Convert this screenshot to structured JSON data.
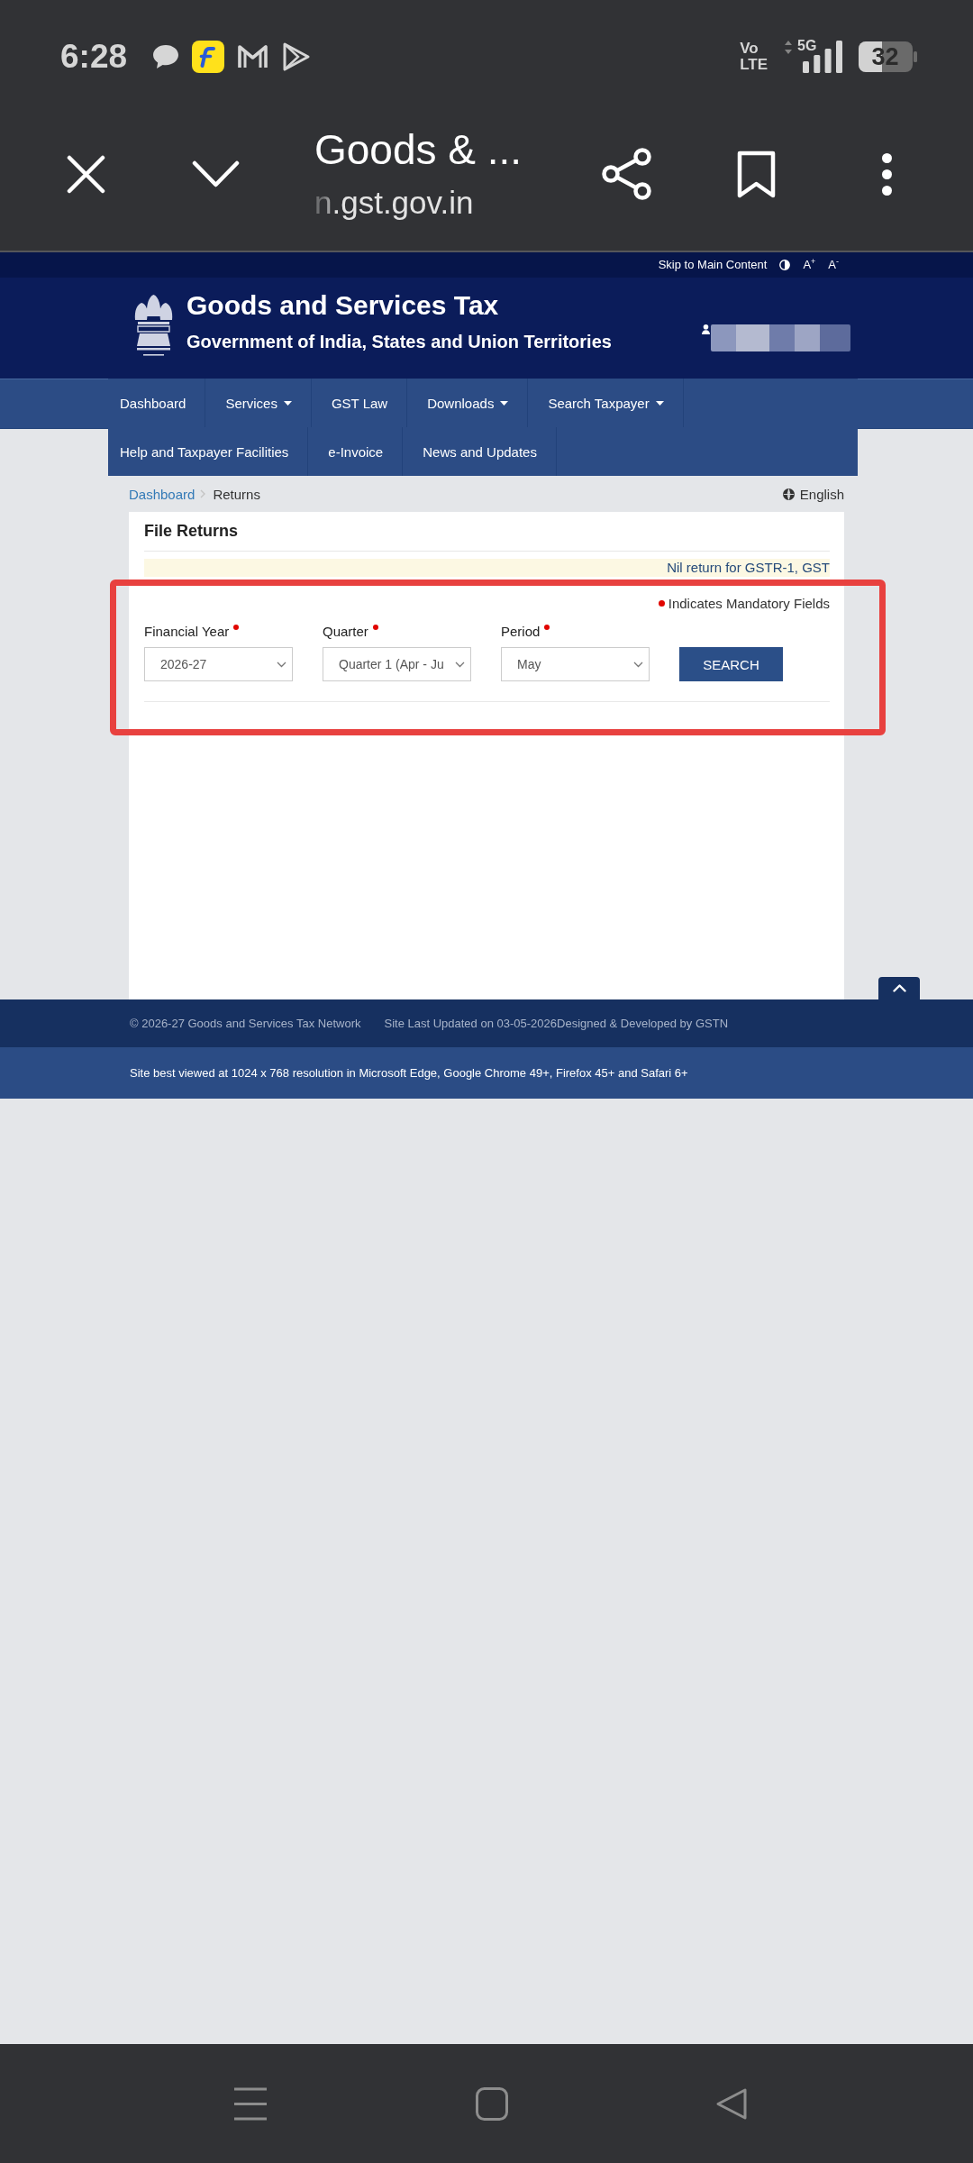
{
  "status_bar": {
    "time": "6:28",
    "volte": [
      "Vo",
      "LTE"
    ],
    "network": "5G",
    "battery": "32"
  },
  "browser_bar": {
    "title": "Goods & ...",
    "url": "n.gst.gov.in"
  },
  "site_toolbar": {
    "skip_link": "Skip to Main Content",
    "font_controls": [
      "A$^{+}$",
      "A$^{-}$"
    ]
  },
  "header": {
    "title": "Goods and Services Tax",
    "subtitle": "Government of India, States and Union Territories"
  },
  "nav": {
    "items": [
      {
        "label": "Dashboard",
        "dropdown": false
      },
      {
        "label": "Services",
        "dropdown": true
      },
      {
        "label": "GST Law",
        "dropdown": false
      },
      {
        "label": "Downloads",
        "dropdown": true
      },
      {
        "label": "Search Taxpayer",
        "dropdown": true
      },
      {
        "label": "Help and Taxpayer Facilities",
        "dropdown": false
      },
      {
        "label": "e-Invoice",
        "dropdown": false
      },
      {
        "label": "News and Updates",
        "dropdown": false
      }
    ]
  },
  "breadcrumb": [
    {
      "label": "Dashboard",
      "kind": "link"
    },
    {
      "label": "Returns",
      "kind": "current"
    }
  ],
  "language": "English",
  "card": {
    "title": "File Returns",
    "notice": "Nil return for GSTR-1, GST",
    "mandatory_note": "Indicates Mandatory Fields",
    "fields": [
      {
        "label": "Financial Year",
        "required": true,
        "value": "2026-27"
      },
      {
        "label": "Quarter",
        "required": true,
        "value": "Quarter 1 (Apr - Ju"
      },
      {
        "label": "Period",
        "required": true,
        "value": "May"
      }
    ],
    "button": "SEARCH"
  },
  "footer": {
    "copyright": "© 2026-27 Goods and Services Tax Network",
    "updated": "Site Last Updated on 03-05-2026Designed & Developed by GSTN",
    "browser_note": "Site best viewed at 1024 x 768 resolution in Microsoft Edge, Google Chrome 49+, Firefox 45+ and Safari 6+"
  },
  "annotation": {
    "kind": "rectangle"
  }
}
